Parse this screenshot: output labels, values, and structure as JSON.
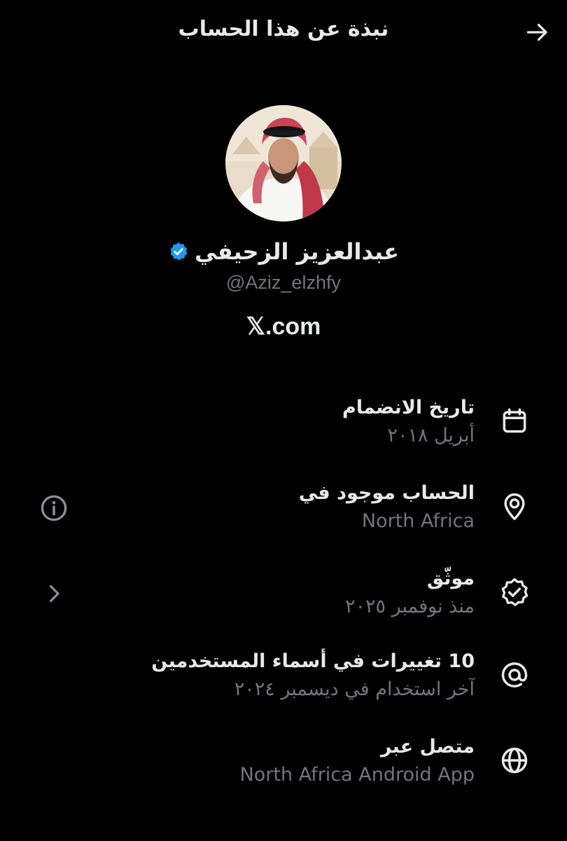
{
  "header": {
    "title": "نبذة عن هذا الحساب",
    "back_icon": "arrow-right-icon"
  },
  "profile": {
    "display_name": "عبدالعزيز الزحيفي",
    "verified_icon": "verified-badge-icon",
    "handle": "@Aziz_elzhfy",
    "brand_link": "𝕏.com"
  },
  "rows": [
    {
      "icon": "calendar-icon",
      "title": "تاريخ الانضمام",
      "subtitle": "أبريل ٢٠١٨"
    },
    {
      "icon": "location-pin-icon",
      "title": "الحساب موجود في",
      "subtitle": "North Africa",
      "side_icon": "info-icon"
    },
    {
      "icon": "verified-seal-icon",
      "title": "موثّق",
      "subtitle": "منذ نوفمبر ٢٠٢٥",
      "side_icon": "chevron-left-icon"
    },
    {
      "icon": "at-sign-icon",
      "title": "10 تغييرات في أسماء المستخدمين",
      "subtitle": "آخر استخدام في ديسمبر ٢٠٢٤"
    },
    {
      "icon": "globe-icon",
      "title": "متصل عبر",
      "subtitle": "North Africa Android App"
    }
  ],
  "colors": {
    "background": "#000000",
    "primary_text": "#e7e9ea",
    "secondary_text": "#71767b",
    "verified_blue": "#1d9bf0"
  }
}
